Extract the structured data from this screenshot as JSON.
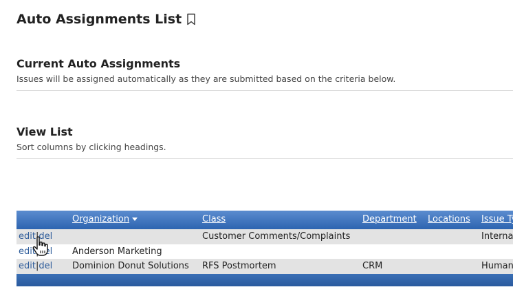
{
  "page": {
    "title": "Auto Assignments List"
  },
  "sections": {
    "current": {
      "heading": "Current Auto Assignments",
      "description": "Issues will be assigned automatically as they are submitted based on the criteria below."
    },
    "view_list": {
      "heading": "View List",
      "description": "Sort columns by clicking headings."
    }
  },
  "table": {
    "columns": {
      "organization": "Organization",
      "class": "Class",
      "department": "Department",
      "locations": "Locations",
      "issue_type": "Issue Ty"
    },
    "sorted_by": "organization",
    "sort_direction": "descending",
    "action_edit": "edit",
    "action_separator": "|",
    "action_del": "del",
    "rows": [
      {
        "organization": "",
        "class": "Customer Comments/Complaints",
        "department": "",
        "locations": "",
        "issue_type": "Internal"
      },
      {
        "organization": "Anderson Marketing",
        "class": "",
        "department": "",
        "locations": "",
        "issue_type": ""
      },
      {
        "organization": "Dominion Donut Solutions",
        "class": "RFS Postmortem",
        "department": "CRM",
        "locations": "",
        "issue_type": "Human"
      }
    ]
  },
  "colors": {
    "header_gradient_top": "#5b8ccf",
    "header_gradient_bottom": "#2d64b0",
    "row_alt": "#e3e3e3",
    "link": "#2e5c9a"
  },
  "icons": {
    "title_bookmark": "bookmark-icon",
    "cursor": "hand-pointer-icon"
  }
}
